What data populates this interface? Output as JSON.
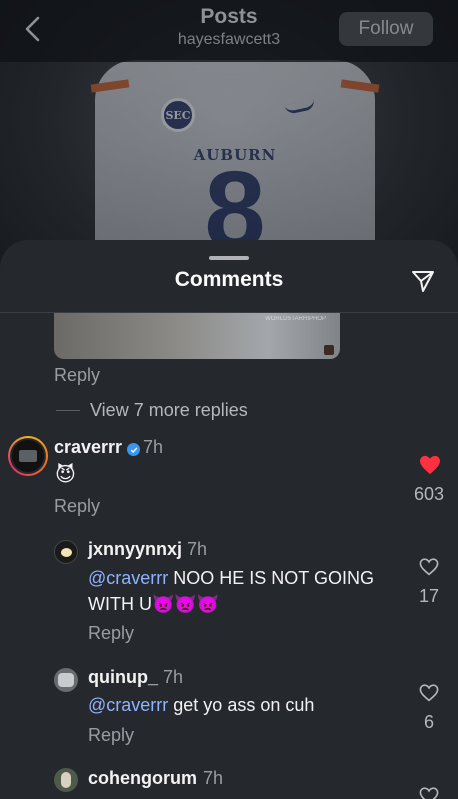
{
  "header": {
    "title": "Posts",
    "subtitle": "hayesfawcett3",
    "follow_label": "Follow"
  },
  "post_image": {
    "jersey_team": "AUBURN",
    "jersey_number": "8",
    "badge": "SEC"
  },
  "comments_sheet": {
    "title": "Comments",
    "media_watermark": "WORLDSTARHIPHOP",
    "reply_label": "Reply",
    "view_more_label": "View 7 more replies",
    "comments": [
      {
        "username": "craverrr",
        "verified": true,
        "time": "7h",
        "text": "😈",
        "likes": "603",
        "liked": true,
        "reply_label": "Reply"
      }
    ],
    "replies": [
      {
        "username": "jxnnyynnxj",
        "time": "7h",
        "mention": "@craverrr",
        "text_line1": " NOO HE IS NOT GOING",
        "text_line2": "WITH U👿👿👿",
        "likes": "17",
        "reply_label": "Reply"
      },
      {
        "username": "quinup_",
        "time": "7h",
        "mention": "@craverrr",
        "text": " get yo ass on cuh",
        "likes": "6",
        "reply_label": "Reply"
      },
      {
        "username": "cohengorum",
        "time": "7h"
      }
    ]
  },
  "colors": {
    "sheet_bg": "#25282d",
    "mention": "#8fb3ff",
    "like_red": "#ff3040",
    "verified_blue": "#3897f0"
  }
}
